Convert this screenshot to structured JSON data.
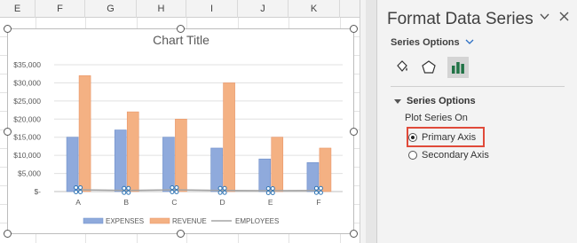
{
  "sheet": {
    "columns": [
      "E",
      "F",
      "G",
      "H",
      "I",
      "J",
      "K"
    ]
  },
  "chart_data": {
    "type": "bar",
    "title": "Chart Title",
    "categories": [
      "A",
      "B",
      "C",
      "D",
      "E",
      "F"
    ],
    "series": [
      {
        "name": "EXPENSES",
        "type": "bar",
        "color": "#8faadc",
        "values": [
          15000,
          17000,
          15000,
          12000,
          9000,
          8000
        ]
      },
      {
        "name": "REVENUE",
        "type": "bar",
        "color": "#f4b183",
        "values": [
          32000,
          22000,
          20000,
          30000,
          15000,
          12000
        ]
      },
      {
        "name": "EMPLOYEES",
        "type": "line",
        "color": "#a5a5a5",
        "values": [
          500,
          300,
          500,
          300,
          250,
          300
        ]
      }
    ],
    "y_ticks": [
      "$-",
      "$5,000",
      "$10,000",
      "$15,000",
      "$20,000",
      "$25,000",
      "$30,000",
      "$35,000"
    ],
    "ylim": [
      0,
      35000
    ],
    "grid": true,
    "legend_position": "bottom"
  },
  "pane": {
    "title": "Format Data Series",
    "series_options_label": "Series Options",
    "section_label": "Series Options",
    "plot_series_on": "Plot Series On",
    "primary_axis": "Primary Axis",
    "secondary_axis": "Secondary Axis",
    "selected_axis": "primary",
    "highlight_color": "#e04a3a",
    "icons": [
      "fill-bucket-icon",
      "pentagon-icon",
      "bar-chart-icon"
    ]
  }
}
